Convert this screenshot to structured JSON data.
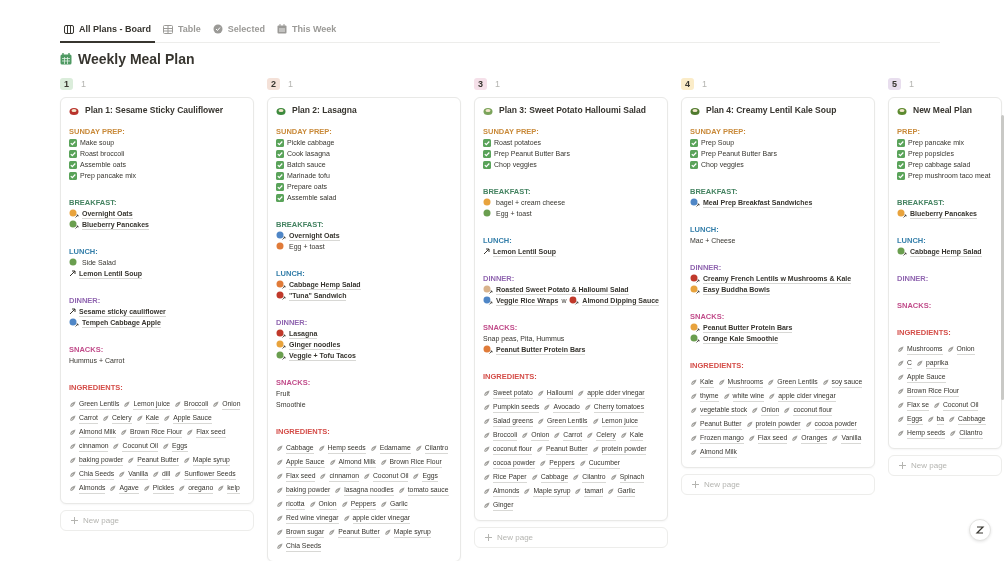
{
  "tabs": [
    {
      "label": "All Plans - Board",
      "kind": "board",
      "selected": true
    },
    {
      "label": "Table",
      "kind": "table",
      "selected": false
    },
    {
      "label": "Selected",
      "kind": "check",
      "selected": false
    },
    {
      "label": "This Week",
      "kind": "calendar",
      "selected": false
    }
  ],
  "title": "Weekly Meal Plan",
  "columns": [
    {
      "label": "1",
      "count": "1",
      "color": "#dbeddb",
      "new_page": "New page",
      "cards": [
        {
          "title": "Plan 1: Sesame Sticky Cauliflower",
          "sections": [
            {
              "heading": "SUNDAY PREP:",
              "color": "#c98a3a",
              "items": [
                {
                  "kind": "check",
                  "text": "Make soup",
                  "checked": true
                },
                {
                  "kind": "check",
                  "text": "Roast broccoli",
                  "checked": true
                },
                {
                  "kind": "check",
                  "text": "Assemble oats",
                  "checked": true
                },
                {
                  "kind": "check",
                  "text": "Prep pancake mix",
                  "checked": true
                }
              ]
            },
            {
              "heading": "BREAKFAST:",
              "color": "#448361",
              "items": [
                {
                  "kind": "link",
                  "text": "Overnight Oats"
                },
                {
                  "kind": "link",
                  "text": "Blueberry Pancakes"
                }
              ]
            },
            {
              "heading": "LUNCH:",
              "color": "#337ea9",
              "items": [
                {
                  "kind": "plain",
                  "text": "Side Salad"
                },
                {
                  "kind": "bare-link",
                  "text": "Lemon Lentil Soup"
                }
              ]
            },
            {
              "heading": "DINNER:",
              "color": "#9065b0",
              "items": [
                {
                  "kind": "bare-link",
                  "text": "Sesame sticky cauliflower"
                },
                {
                  "kind": "link",
                  "text": "Tempeh Cabbage Apple"
                }
              ]
            },
            {
              "heading": "SNACKS:",
              "color": "#c14c8a",
              "items": [
                {
                  "kind": "text",
                  "text": "Hummus + Carrot"
                }
              ]
            },
            {
              "heading": "INGREDIENTS:",
              "color": "#d44c47",
              "tags": [
                "Green Lentils",
                "Lemon juice",
                "Broccoli",
                "Onion",
                "Carrot",
                "Celery",
                "Kale",
                "Apple Sauce",
                "Almond Milk",
                "Brown Rice Flour",
                "Flax seed",
                "cinnamon",
                "Coconut Oil",
                "Eggs",
                "baking powder",
                "Peanut Butter",
                "Maple syrup",
                "Chia Seeds",
                "Vanilla",
                "dill",
                "Sunflower Seeds",
                "Almonds",
                "Agave",
                "Pickles",
                "oregano",
                "kelp"
              ]
            }
          ]
        }
      ]
    },
    {
      "label": "2",
      "count": "1",
      "color": "#f4e1d8",
      "cards": [
        {
          "title": "Plan 2: Lasagna",
          "sections": [
            {
              "heading": "SUNDAY PREP:",
              "color": "#c98a3a",
              "items": [
                {
                  "kind": "check",
                  "text": "Pickle cabbage",
                  "checked": true
                },
                {
                  "kind": "check",
                  "text": "Cook lasagna",
                  "checked": true
                },
                {
                  "kind": "check",
                  "text": "Batch sauce",
                  "checked": true
                },
                {
                  "kind": "check",
                  "text": "Marinade tofu",
                  "checked": true
                },
                {
                  "kind": "check",
                  "text": "Prepare oats",
                  "checked": true
                },
                {
                  "kind": "check",
                  "text": "Assemble salad",
                  "checked": true
                }
              ]
            },
            {
              "heading": "BREAKFAST:",
              "color": "#448361",
              "items": [
                {
                  "kind": "link",
                  "text": "Overnight Oats"
                },
                {
                  "kind": "plain",
                  "text": "Egg + toast"
                }
              ]
            },
            {
              "heading": "LUNCH:",
              "color": "#337ea9",
              "items": [
                {
                  "kind": "link",
                  "text": "Cabbage Hemp Salad"
                },
                {
                  "kind": "link",
                  "text": "\"Tuna\" Sandwich"
                }
              ]
            },
            {
              "heading": "DINNER:",
              "color": "#9065b0",
              "items": [
                {
                  "kind": "link",
                  "text": "Lasagna"
                },
                {
                  "kind": "link",
                  "text": "Ginger noodles"
                },
                {
                  "kind": "link",
                  "text": "Veggie + Tofu Tacos"
                }
              ]
            },
            {
              "heading": "SNACKS:",
              "color": "#c14c8a",
              "items": [
                {
                  "kind": "text",
                  "text": "Fruit"
                },
                {
                  "kind": "text",
                  "text": "Smoothie"
                }
              ]
            },
            {
              "heading": "INGREDIENTS:",
              "color": "#d44c47",
              "tags": [
                "Cabbage",
                "Hemp seeds",
                "Edamame",
                "Cilantro",
                "Apple Sauce",
                "Almond Milk",
                "Brown Rice Flour",
                "Flax seed",
                "cinnamon",
                "Coconut Oil",
                "Eggs",
                "baking powder",
                "lasagna noodles",
                "tomato sauce",
                "ricotta",
                "Onion",
                "Peppers",
                "Garlic",
                "Red wine vinegar",
                "apple cider vinegar",
                "Brown sugar",
                "Peanut Butter",
                "Maple syrup",
                "Chia Seeds"
              ]
            }
          ]
        }
      ]
    },
    {
      "label": "3",
      "count": "1",
      "color": "#f5e0e9",
      "new_page": "New page",
      "cards": [
        {
          "title": "Plan 3: Sweet Potato Halloumi Salad",
          "sections": [
            {
              "heading": "SUNDAY PREP:",
              "color": "#c98a3a",
              "items": [
                {
                  "kind": "check",
                  "text": "Roast potatoes",
                  "checked": true
                },
                {
                  "kind": "check",
                  "text": "Prep Peanut Butter Bars",
                  "checked": true
                },
                {
                  "kind": "check",
                  "text": "Chop veggies",
                  "checked": true
                }
              ]
            },
            {
              "heading": "BREAKFAST:",
              "color": "#448361",
              "items": [
                {
                  "kind": "plain",
                  "text": "bagel + cream cheese"
                },
                {
                  "kind": "plain",
                  "text": "Egg + toast"
                }
              ]
            },
            {
              "heading": "LUNCH:",
              "color": "#337ea9",
              "items": [
                {
                  "kind": "bare-link",
                  "text": "Lemon Lentil Soup"
                }
              ]
            },
            {
              "heading": "DINNER:",
              "color": "#9065b0",
              "items": [
                {
                  "kind": "link",
                  "text": "Roasted Sweet Potato & Halloumi Salad"
                },
                {
                  "kind": "combo",
                  "parts": [
                    {
                      "kind": "link",
                      "text": "Veggie Rice Wraps"
                    },
                    {
                      "kind": "text",
                      "text": "w"
                    },
                    {
                      "kind": "link",
                      "text": "Almond Dipping Sauce"
                    }
                  ]
                }
              ]
            },
            {
              "heading": "SNACKS:",
              "color": "#c14c8a",
              "items": [
                {
                  "kind": "text",
                  "text": "Snap peas, Pita, Hummus"
                },
                {
                  "kind": "link",
                  "text": "Peanut Butter Protein Bars"
                }
              ]
            },
            {
              "heading": "INGREDIENTS:",
              "color": "#d44c47",
              "tags": [
                "Sweet potato",
                "Halloumi",
                "apple cider vinegar",
                "Pumpkin seeds",
                "Avocado",
                "Cherry tomatoes",
                "Salad greens",
                "Green Lentils",
                "Lemon juice",
                "Broccoli",
                "Onion",
                "Carrot",
                "Celery",
                "Kale",
                "coconut flour",
                "Peanut Butter",
                "protein powder",
                "cocoa powder",
                "Peppers",
                "Cucumber",
                "Rice Paper",
                "Cabbage",
                "Cilantro",
                "Spinach",
                "Almonds",
                "Maple syrup",
                "tamari",
                "Garlic",
                "Ginger"
              ]
            }
          ]
        }
      ]
    },
    {
      "label": "4",
      "count": "1",
      "color": "#fbecc8",
      "new_page": "New page",
      "cards": [
        {
          "title": "Plan 4: Creamy Lentil Kale Soup",
          "sections": [
            {
              "heading": "SUNDAY PREP:",
              "color": "#c98a3a",
              "items": [
                {
                  "kind": "check",
                  "text": "Prep Soup",
                  "checked": true
                },
                {
                  "kind": "check",
                  "text": "Prep Peanut Butter Bars",
                  "checked": true
                },
                {
                  "kind": "check",
                  "text": "Chop veggies",
                  "checked": true
                }
              ]
            },
            {
              "heading": "BREAKFAST:",
              "color": "#448361",
              "items": [
                {
                  "kind": "link",
                  "text": "Meal Prep Breakfast Sandwiches"
                }
              ]
            },
            {
              "heading": "LUNCH:",
              "color": "#337ea9",
              "items": [
                {
                  "kind": "text",
                  "text": "Mac + Cheese"
                }
              ]
            },
            {
              "heading": "DINNER:",
              "color": "#9065b0",
              "items": [
                {
                  "kind": "link",
                  "text": "Creamy  French Lentils w Mushrooms & Kale"
                },
                {
                  "kind": "link",
                  "text": "Easy Buddha Bowls"
                }
              ]
            },
            {
              "heading": "SNACKS:",
              "color": "#c14c8a",
              "items": [
                {
                  "kind": "link",
                  "text": "Peanut Butter Protein Bars"
                },
                {
                  "kind": "link",
                  "text": "Orange Kale Smoothie"
                }
              ]
            },
            {
              "heading": "INGREDIENTS:",
              "color": "#d44c47",
              "tags": [
                "Kale",
                "Mushrooms",
                "Green Lentils",
                "soy sauce",
                "thyme",
                "white wine",
                "apple cider vinegar",
                "vegetable stock",
                "Onion",
                "coconut flour",
                "Peanut Butter",
                "protein powder",
                "cocoa powder",
                "Frozen mango",
                "Flax seed",
                "Oranges",
                "Vanilla",
                "Almond Milk"
              ]
            }
          ]
        }
      ]
    },
    {
      "label": "5",
      "count": "1",
      "color": "#e8deee",
      "new_page": "New page",
      "cards": [
        {
          "title": "New Meal Plan",
          "sections": [
            {
              "heading": "PREP:",
              "color": "#c98a3a",
              "items": [
                {
                  "kind": "check",
                  "text": "Prep pancake mix",
                  "checked": true
                },
                {
                  "kind": "check",
                  "text": "Prep popsicles",
                  "checked": true
                },
                {
                  "kind": "check",
                  "text": "Prep cabbage salad",
                  "checked": true
                },
                {
                  "kind": "check",
                  "text": "Prep mushroom taco meat",
                  "checked": true
                }
              ]
            },
            {
              "heading": "BREAKFAST:",
              "color": "#448361",
              "items": [
                {
                  "kind": "link",
                  "text": "Blueberry Pancakes"
                }
              ]
            },
            {
              "heading": "LUNCH:",
              "color": "#337ea9",
              "items": [
                {
                  "kind": "link",
                  "text": "Cabbage Hemp Salad"
                }
              ]
            },
            {
              "heading": "DINNER:",
              "color": "#9065b0"
            },
            {
              "heading": "SNACKS:",
              "color": "#c14c8a"
            },
            {
              "heading": "INGREDIENTS:",
              "color": "#d44c47",
              "tags": [
                "Mushrooms",
                "Onion",
                "C",
                "paprika",
                "Apple Sauce",
                "Brown Rice Flour",
                "Flax se",
                "Coconut Oil",
                "Eggs",
                "ba",
                "Cabbage",
                "Hemp seeds",
                "Cilantro"
              ]
            }
          ]
        }
      ]
    }
  ]
}
